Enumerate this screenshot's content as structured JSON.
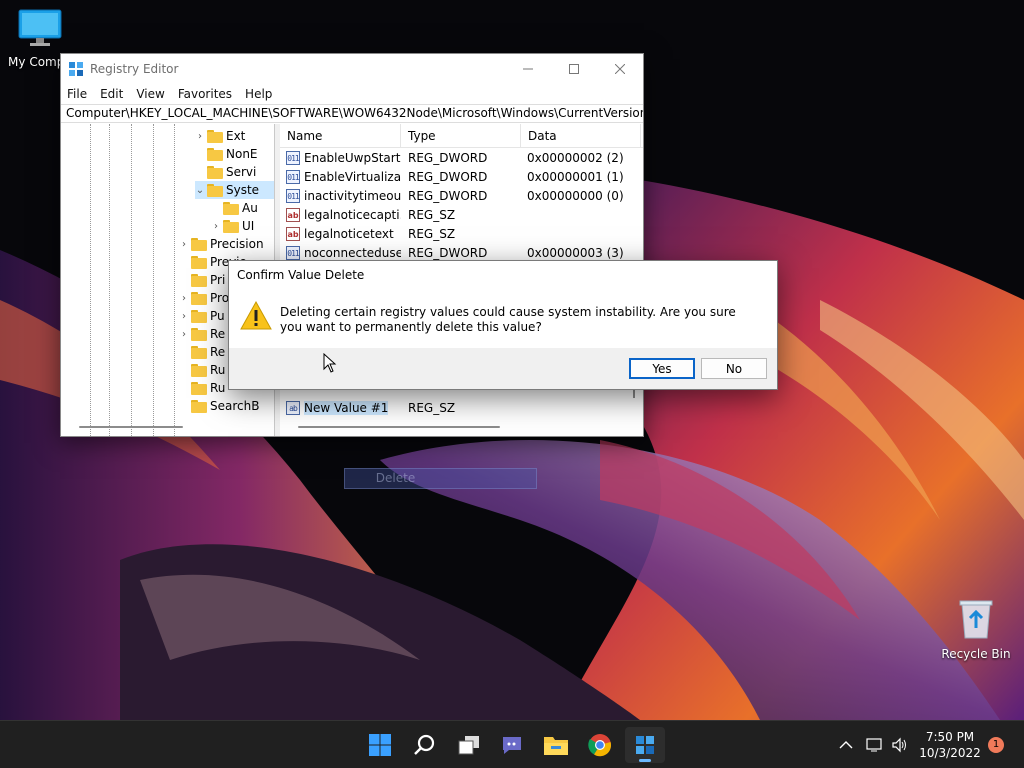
{
  "desktop": {
    "computer_label": "My Compu",
    "recycle_label": "Recycle Bin"
  },
  "regedit": {
    "title": "Registry Editor",
    "menu": [
      "File",
      "Edit",
      "View",
      "Favorites",
      "Help"
    ],
    "address": "Computer\\HKEY_LOCAL_MACHINE\\SOFTWARE\\WOW6432Node\\Microsoft\\Windows\\CurrentVersion\\Policie",
    "tree": {
      "ext": "Ext",
      "nonb": "NonE",
      "servi": "Servi",
      "syste": "Syste",
      "au": "Au",
      "ui": "UI",
      "precision": "Precision",
      "previo": "Previo",
      "pri": "Pri",
      "pro": "Pro",
      "pu": "Pu",
      "re1": "Re",
      "re2": "Re",
      "ru1": "Ru",
      "ru2": "Ru",
      "searchb": "SearchB"
    },
    "columns": {
      "name": "Name",
      "type": "Type",
      "data": "Data"
    },
    "values": [
      {
        "name": "EnableUwpStart...",
        "type": "REG_DWORD",
        "data": "0x00000002 (2)",
        "icon": "dword"
      },
      {
        "name": "EnableVirtualizat...",
        "type": "REG_DWORD",
        "data": "0x00000001 (1)",
        "icon": "dword"
      },
      {
        "name": "inactivitytimeou...",
        "type": "REG_DWORD",
        "data": "0x00000000 (0)",
        "icon": "dword"
      },
      {
        "name": "legalnoticecapti...",
        "type": "REG_SZ",
        "data": "",
        "icon": "sz"
      },
      {
        "name": "legalnoticetext",
        "type": "REG_SZ",
        "data": "",
        "icon": "sz"
      },
      {
        "name": "noconnecteduser",
        "type": "REG_DWORD",
        "data": "0x00000003 (3)",
        "icon": "dword"
      }
    ],
    "new_value": {
      "name": "New Value #1",
      "type": "REG_SZ",
      "data": "",
      "icon": "dword"
    }
  },
  "ghost_menu": {
    "label": "Delete"
  },
  "dialog": {
    "title": "Confirm Value Delete",
    "message": "Deleting certain registry values could cause system instability. Are you sure you want to permanently delete this value?",
    "yes": "Yes",
    "no": "No"
  },
  "taskbar": {
    "time": "7:50 PM",
    "date": "10/3/2022",
    "notifications": "1"
  },
  "icons": {
    "app": "registry-icon",
    "warning": "warning-icon"
  },
  "colors": {
    "accent": "#0a64c8",
    "selection": "#cce8ff",
    "taskbar": "#202020"
  }
}
